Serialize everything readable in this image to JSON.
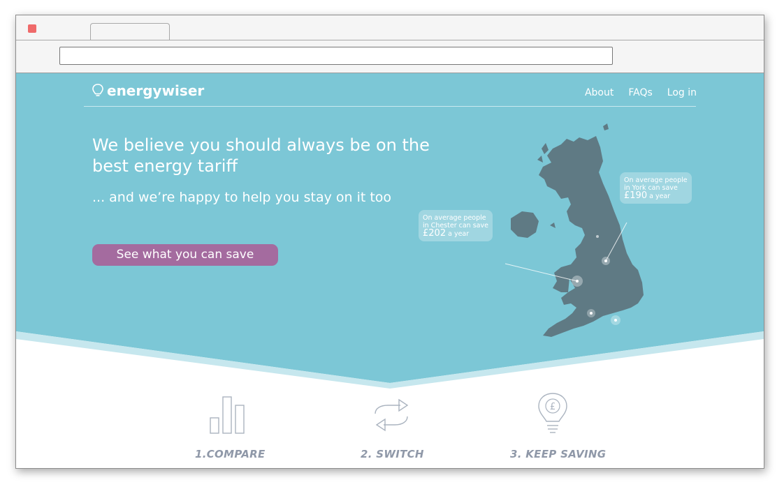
{
  "browser": {
    "tab_title": "",
    "address": ""
  },
  "brand": {
    "name": "energywiser"
  },
  "nav": {
    "about": "About",
    "faqs": "FAQs",
    "login": "Log in"
  },
  "hero": {
    "headline": "We believe you should always be on the best energy tariff",
    "subline": "... and we’re happy to help you stay on it too",
    "cta": "See what you can save"
  },
  "callouts": [
    {
      "line1": "On average people",
      "line2": "in York can save",
      "amount": "£190",
      "unit": "a year"
    },
    {
      "line1": "On average people",
      "line2": "in Chester can save",
      "amount": "£202",
      "unit": "a year"
    }
  ],
  "steps": [
    {
      "label": "1.COMPARE",
      "icon": "bar-chart-icon"
    },
    {
      "label": "2. SWITCH",
      "icon": "switch-arrows-icon"
    },
    {
      "label": "3. KEEP SAVING",
      "icon": "lightbulb-pound-icon"
    }
  ],
  "colors": {
    "hero_bg": "#7cc7d6",
    "map": "#5f7a84",
    "cta_bg": "#a46b9f",
    "step_label": "#8f98a8"
  }
}
